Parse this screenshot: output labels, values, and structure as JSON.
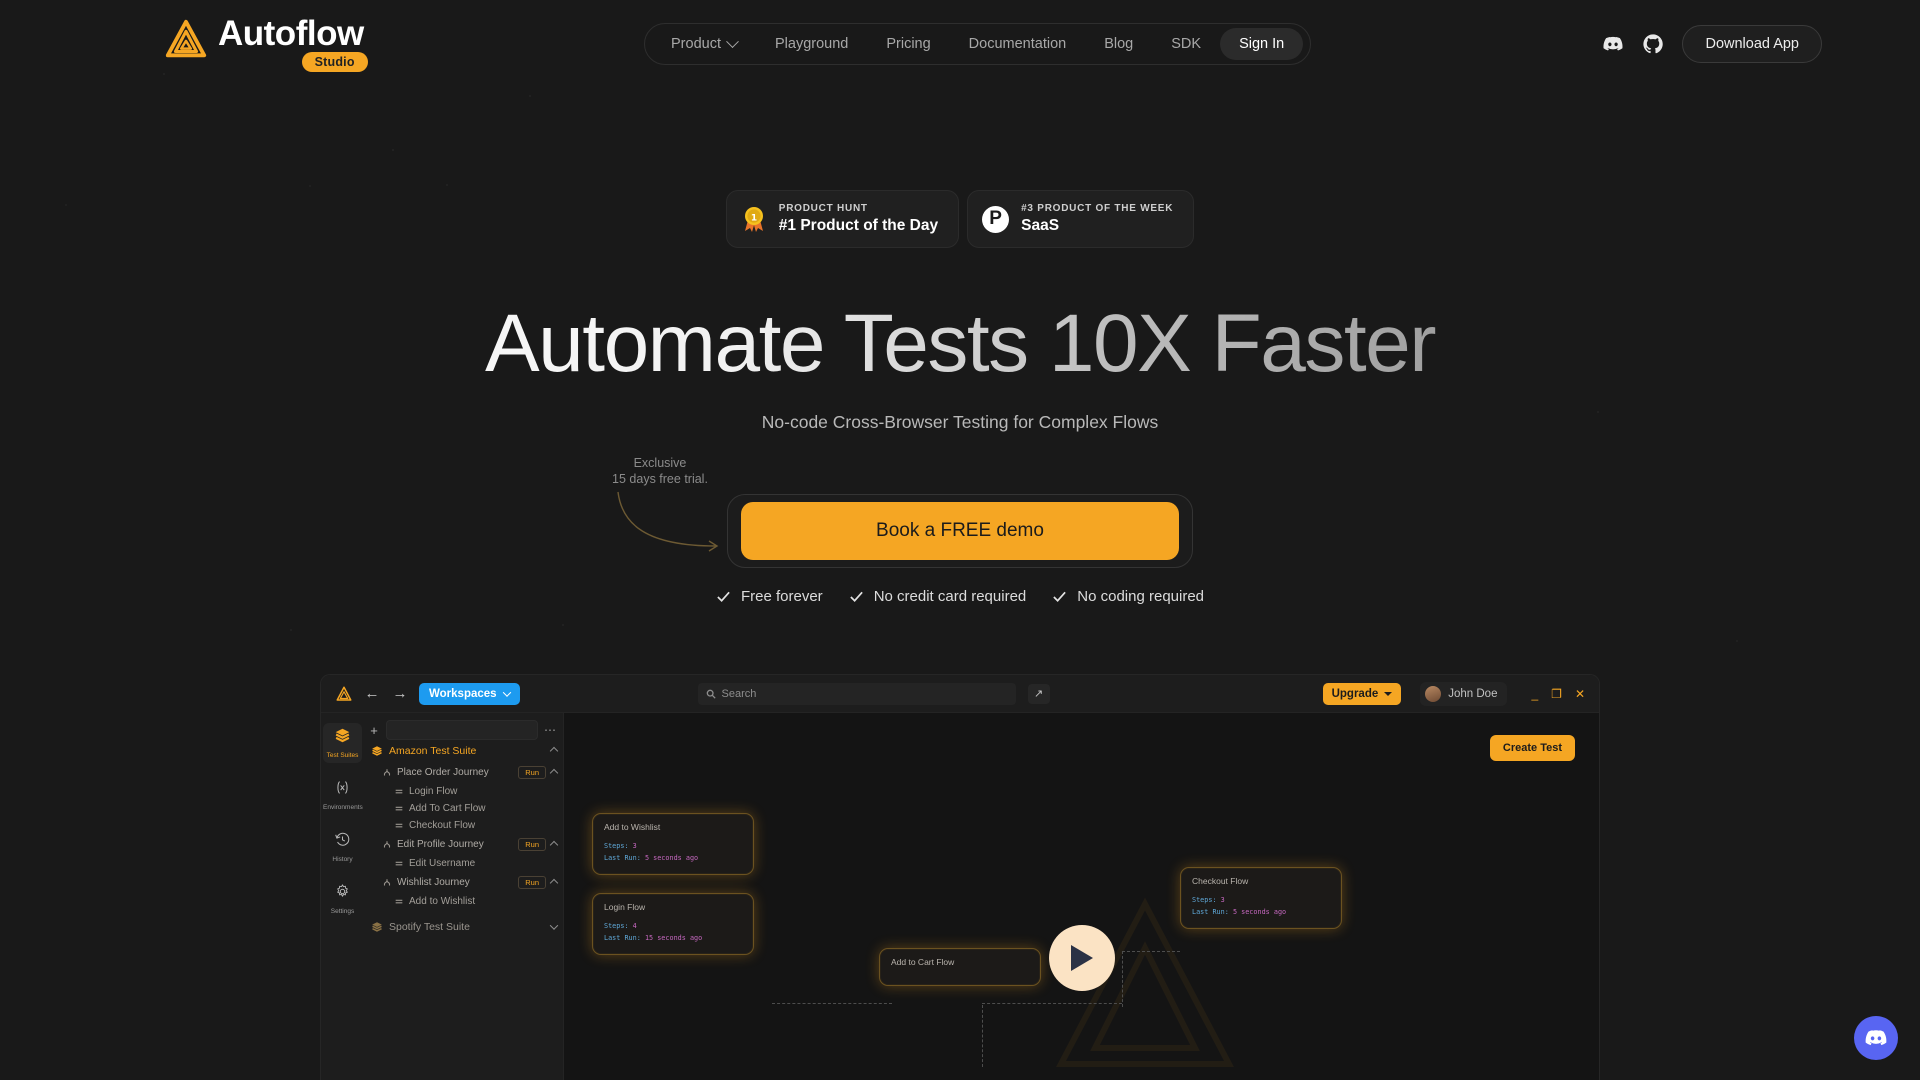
{
  "brand": {
    "name": "Autoflow",
    "badge": "Studio",
    "logo_icon": "autoflow-triangle-logo"
  },
  "nav": {
    "items": [
      {
        "label": "Product",
        "has_dropdown": true
      },
      {
        "label": "Playground",
        "has_dropdown": false
      },
      {
        "label": "Pricing",
        "has_dropdown": false
      },
      {
        "label": "Documentation",
        "has_dropdown": false
      },
      {
        "label": "Blog",
        "has_dropdown": false
      },
      {
        "label": "SDK",
        "has_dropdown": false
      },
      {
        "label": "Sign In",
        "has_dropdown": false
      }
    ],
    "discord_icon": "discord-icon",
    "github_icon": "github-icon",
    "download_label": "Download App"
  },
  "badges": [
    {
      "icon": "gold-medal-icon",
      "kicker": "PRODUCT HUNT",
      "title": "#1 Product of the Day"
    },
    {
      "icon": "product-hunt-p-icon",
      "kicker": "#3 PRODUCT OF THE WEEK",
      "title": "SaaS"
    }
  ],
  "hero": {
    "headline": "Automate Tests 10X Faster",
    "subheadline": "No-code Cross-Browser Testing for Complex Flows",
    "annotation_line1": "Exclusive",
    "annotation_line2": "15 days free trial.",
    "cta_label": "Book a FREE demo",
    "checks": [
      "Free forever",
      "No credit card required",
      "No coding required"
    ],
    "accent_color": "#F5A623"
  },
  "app": {
    "toolbar": {
      "workspaces_label": "Workspaces",
      "search_placeholder": "Search",
      "upgrade_label": "Upgrade",
      "user_name": "John Doe",
      "back_icon": "arrow-left-icon",
      "forward_icon": "arrow-right-icon",
      "share_icon": "share-icon",
      "minimize_icon": "minimize-icon",
      "maximize_icon": "maximize-icon",
      "close_icon": "close-icon"
    },
    "rail": [
      {
        "label": "Test Suites",
        "icon": "layers-icon",
        "active": true
      },
      {
        "label": "Environments",
        "icon": "variable-icon",
        "active": false
      },
      {
        "label": "History",
        "icon": "clock-history-icon",
        "active": false
      },
      {
        "label": "Settings",
        "icon": "gear-icon",
        "active": false
      }
    ],
    "tree": {
      "suites": [
        {
          "name": "Amazon Test Suite",
          "expanded": true,
          "journeys": [
            {
              "name": "Place Order Journey",
              "run_label": "Run",
              "flows": [
                "Login Flow",
                "Add To Cart Flow",
                "Checkout Flow"
              ]
            },
            {
              "name": "Edit Profile Journey",
              "run_label": "Run",
              "flows": [
                "Edit Username"
              ]
            },
            {
              "name": "Wishlist Journey",
              "run_label": "Run",
              "flows": [
                "Add to Wishlist"
              ]
            }
          ]
        },
        {
          "name": "Spotify Test Suite",
          "expanded": false,
          "journeys": []
        }
      ]
    },
    "canvas": {
      "create_test_label": "Create Test",
      "steps_label": "Steps:",
      "last_run_label": "Last Run:",
      "cards": [
        {
          "title": "Add to Wishlist",
          "steps": "3",
          "last_run": "5 seconds ago"
        },
        {
          "title": "Login Flow",
          "steps": "4",
          "last_run": "15 seconds ago"
        },
        {
          "title": "Checkout Flow",
          "steps": "3",
          "last_run": "5 seconds ago"
        },
        {
          "title": "Add to Cart Flow",
          "steps": "",
          "last_run": ""
        }
      ],
      "play_icon": "play-button-icon"
    }
  },
  "chat": {
    "icon": "discord-chat-icon"
  }
}
